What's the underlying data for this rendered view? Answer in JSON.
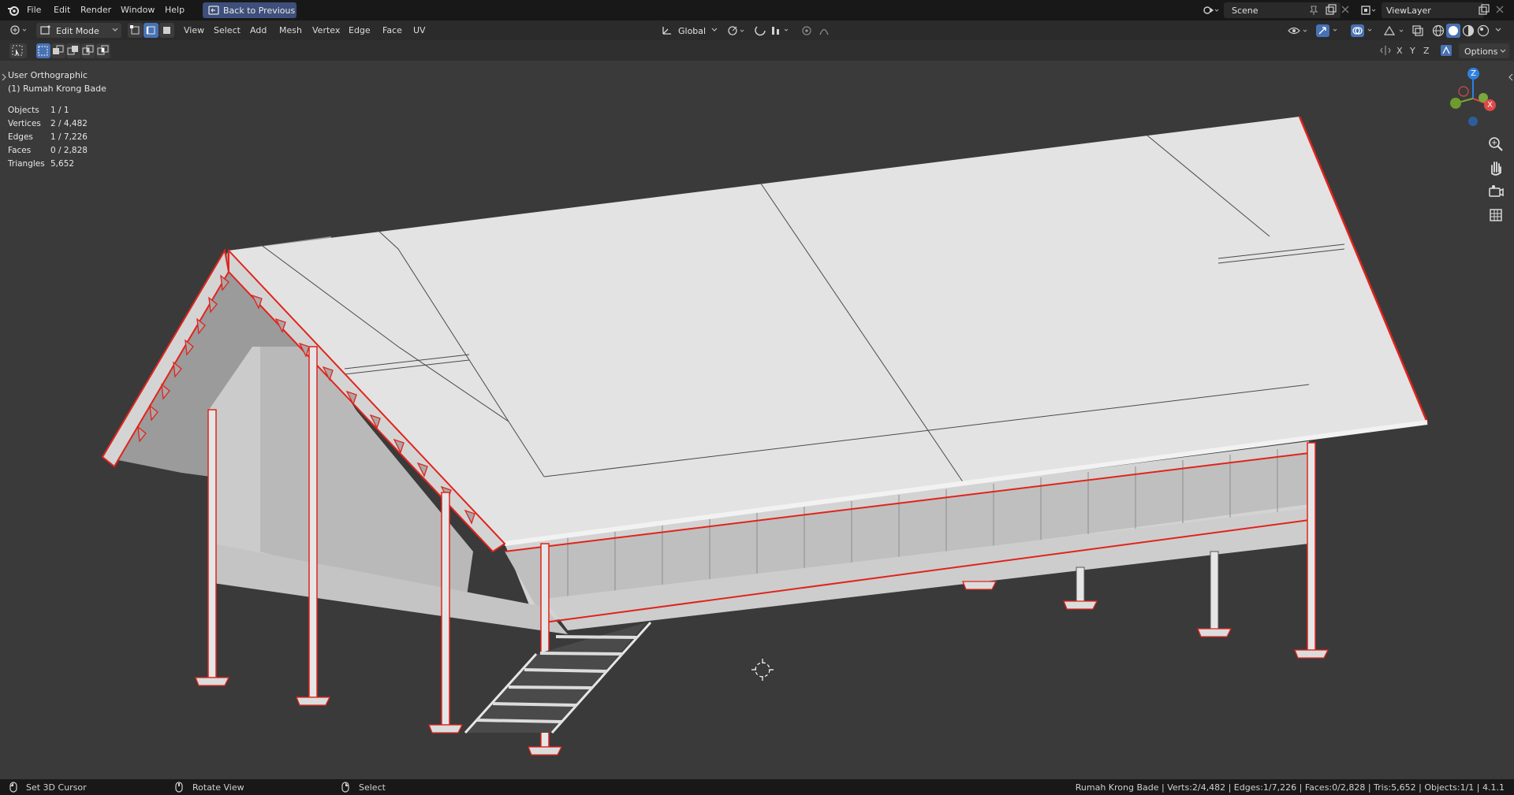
{
  "menu": {
    "file": "File",
    "edit": "Edit",
    "render": "Render",
    "window": "Window",
    "help": "Help",
    "back": "Back to Previous"
  },
  "scene": {
    "name": "Scene",
    "view_layer": "ViewLayer"
  },
  "editor_header": {
    "mode": "Edit Mode",
    "menus": [
      "View",
      "Select",
      "Add",
      "Mesh",
      "Vertex",
      "Edge",
      "Face",
      "UV"
    ],
    "transform_orientation": "Global",
    "options": "Options",
    "axes": [
      "X",
      "Y",
      "Z"
    ]
  },
  "viewport": {
    "view_name": "User Orthographic",
    "object_name": "(1) Rumah Krong Bade",
    "stats": [
      {
        "label": "Objects",
        "value": "1 / 1"
      },
      {
        "label": "Vertices",
        "value": "2 / 4,482"
      },
      {
        "label": "Edges",
        "value": "1 / 7,226"
      },
      {
        "label": "Faces",
        "value": "0 / 2,828"
      },
      {
        "label": "Triangles",
        "value": "5,652"
      }
    ],
    "gizmo": {
      "z": "Z",
      "x": "X"
    }
  },
  "status": {
    "left1": "Set 3D Cursor",
    "left2": "Rotate View",
    "left3": "Select",
    "right": "Rumah Krong Bade | Verts:2/4,482 | Edges:1/7,226 | Faces:0/2,828 | Tris:5,652 | Objects:1/1 | 4.1.1"
  },
  "colors": {
    "selection": "#e0241c",
    "accent": "#4772b3",
    "background": "#3a3a3a"
  }
}
